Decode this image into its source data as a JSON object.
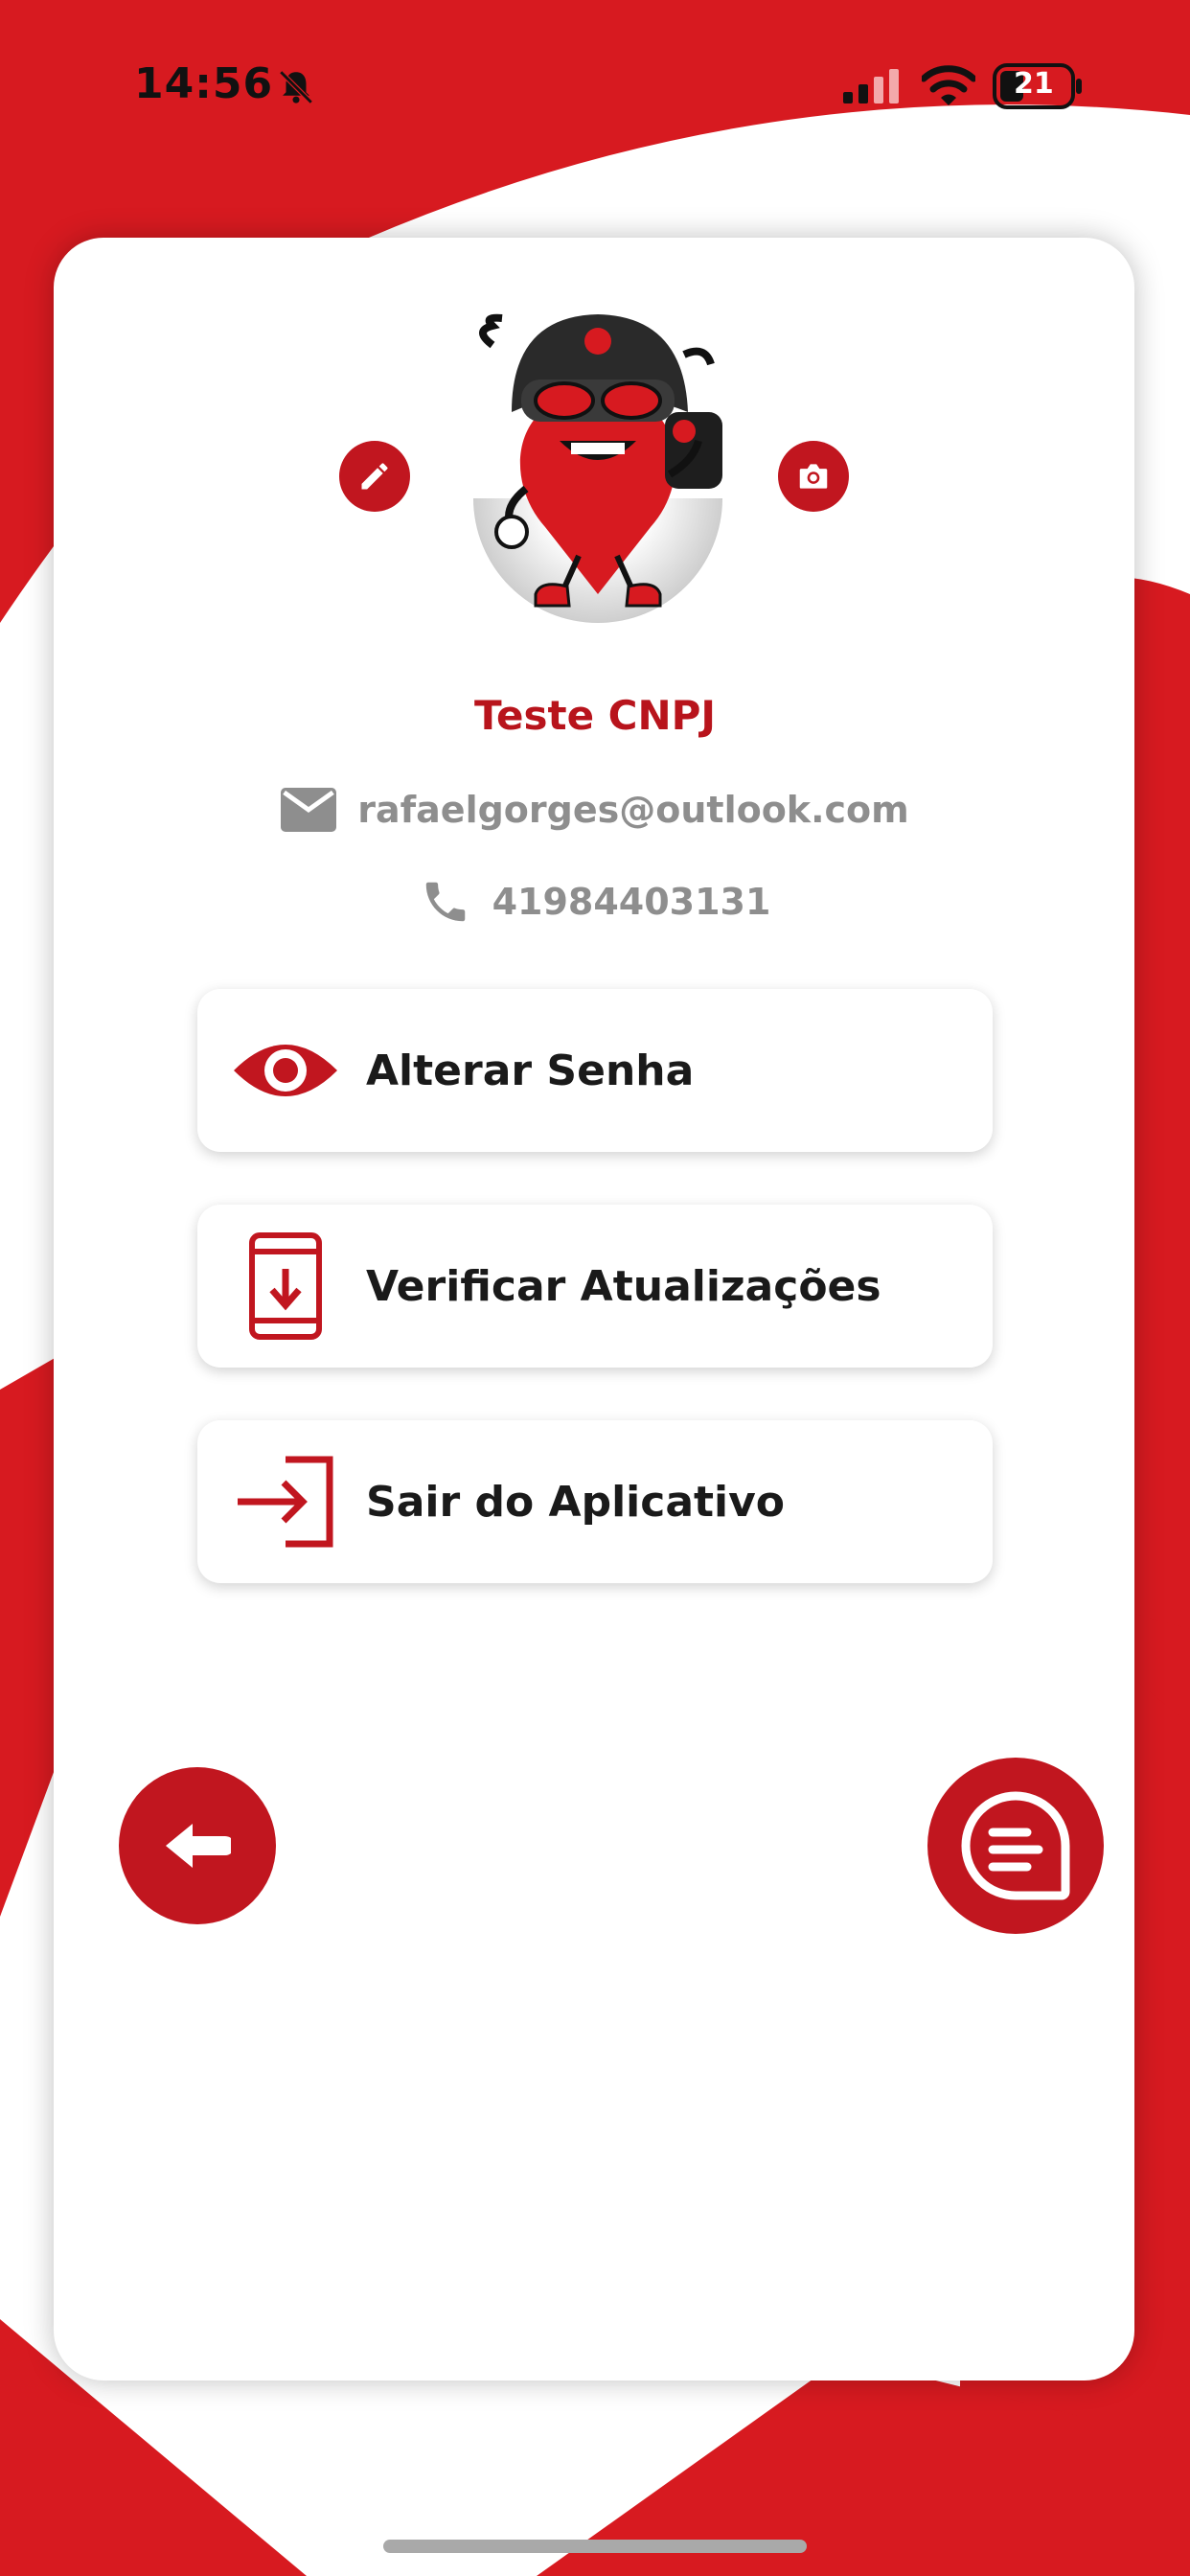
{
  "status_bar": {
    "time": "14:56",
    "battery": "21",
    "icons": [
      "bell-muted-icon",
      "signal-icon",
      "wifi-icon",
      "battery-icon"
    ]
  },
  "profile": {
    "name": "Teste CNPJ",
    "email": "rafaelgorges@outlook.com",
    "phone": "41984403131",
    "avatar": "mascot-avatar",
    "edit_icon": "pencil-icon",
    "photo_icon": "camera-icon"
  },
  "menu": [
    {
      "label": "Alterar Senha",
      "icon": "eye-icon"
    },
    {
      "label": "Verificar Atualizações",
      "icon": "phone-download-icon"
    },
    {
      "label": "Sair do Aplicativo",
      "icon": "logout-icon"
    }
  ],
  "actions": {
    "back_icon": "arrow-left-icon",
    "chat_icon": "chat-icon"
  },
  "colors": {
    "brand_red": "#c1161f",
    "background_red": "#d71a20",
    "card": "#ffffff",
    "muted_text": "#8e8e8e"
  }
}
